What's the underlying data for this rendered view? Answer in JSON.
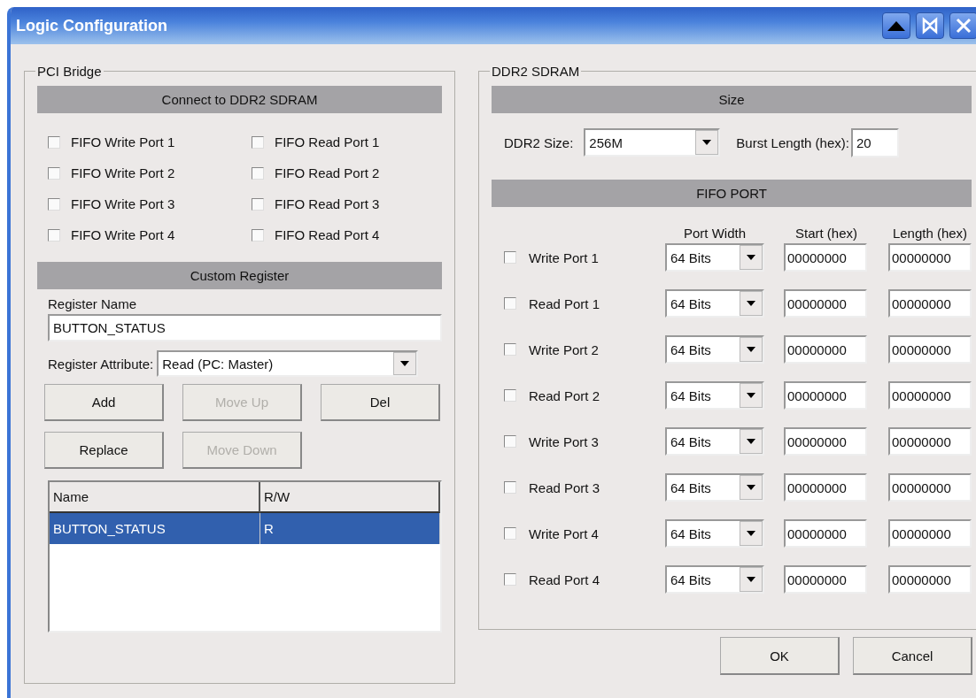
{
  "window": {
    "title": "Logic Configuration"
  },
  "pci_bridge": {
    "title": "PCI Bridge",
    "connect_header": "Connect to DDR2 SDRAM",
    "fifo_ports": [
      {
        "label": "FIFO Write Port 1",
        "checked": false
      },
      {
        "label": "FIFO Read Port 1",
        "checked": false
      },
      {
        "label": "FIFO Write Port 2",
        "checked": false
      },
      {
        "label": "FIFO Read Port 2",
        "checked": false
      },
      {
        "label": "FIFO Write Port 3",
        "checked": false
      },
      {
        "label": "FIFO Read Port 3",
        "checked": false
      },
      {
        "label": "FIFO Write Port 4",
        "checked": false
      },
      {
        "label": "FIFO Read Port 4",
        "checked": false
      }
    ],
    "custom_register_header": "Custom Register",
    "register_name": {
      "label": "Register Name",
      "value": "BUTTON_STATUS"
    },
    "register_attribute": {
      "label": "Register Attribute:",
      "value": "Read (PC: Master)"
    },
    "buttons": [
      {
        "label": "Add",
        "disabled": false
      },
      {
        "label": "Move Up",
        "disabled": true
      },
      {
        "label": "Del",
        "disabled": false
      },
      {
        "label": "Replace",
        "disabled": false
      },
      {
        "label": "Move Down",
        "disabled": true
      }
    ],
    "table": {
      "columns": [
        "Name",
        "R/W"
      ],
      "rows": [
        {
          "cells": [
            "BUTTON_STATUS",
            "R"
          ],
          "selected": true
        }
      ]
    }
  },
  "ddr2_sdram": {
    "title": "DDR2 SDRAM",
    "size_header": "Size",
    "ddr2_size": {
      "label": "DDR2 Size:",
      "value": "256M"
    },
    "burst_length": {
      "label": "Burst Length (hex):",
      "value": "20"
    },
    "fifo_header": "FIFO PORT",
    "columns": [
      "Port Width",
      "Start (hex)",
      "Length (hex)"
    ],
    "ports": [
      {
        "label": "Write Port 1",
        "checked": false,
        "width": "64 Bits",
        "start": "00000000",
        "length": "00000000"
      },
      {
        "label": "Read Port 1",
        "checked": false,
        "width": "64 Bits",
        "start": "00000000",
        "length": "00000000"
      },
      {
        "label": "Write Port 2",
        "checked": false,
        "width": "64 Bits",
        "start": "00000000",
        "length": "00000000"
      },
      {
        "label": "Read Port 2",
        "checked": false,
        "width": "64 Bits",
        "start": "00000000",
        "length": "00000000"
      },
      {
        "label": "Write Port 3",
        "checked": false,
        "width": "64 Bits",
        "start": "00000000",
        "length": "00000000"
      },
      {
        "label": "Read Port 3",
        "checked": false,
        "width": "64 Bits",
        "start": "00000000",
        "length": "00000000"
      },
      {
        "label": "Write Port 4",
        "checked": false,
        "width": "64 Bits",
        "start": "00000000",
        "length": "00000000"
      },
      {
        "label": "Read Port 4",
        "checked": false,
        "width": "64 Bits",
        "start": "00000000",
        "length": "00000000"
      }
    ]
  },
  "footer_buttons": [
    "OK",
    "Cancel"
  ]
}
